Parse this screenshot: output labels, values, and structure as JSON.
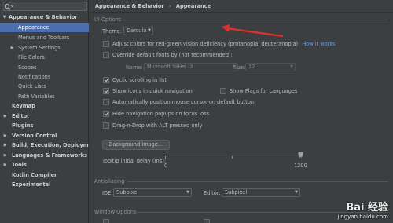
{
  "sidebar": {
    "items": [
      {
        "label": "Appearance & Behavior",
        "level": 0,
        "arrow": "down",
        "bold": true
      },
      {
        "label": "Appearance",
        "level": 1,
        "selected": true
      },
      {
        "label": "Menus and Toolbars",
        "level": 1
      },
      {
        "label": "System Settings",
        "level": 1,
        "arrow": "right"
      },
      {
        "label": "File Colors",
        "level": 1
      },
      {
        "label": "Scopes",
        "level": 1
      },
      {
        "label": "Notifications",
        "level": 1
      },
      {
        "label": "Quick Lists",
        "level": 1
      },
      {
        "label": "Path Variables",
        "level": 1
      },
      {
        "label": "Keymap",
        "level": 0,
        "bold": true
      },
      {
        "label": "Editor",
        "level": 0,
        "arrow": "right",
        "bold": true
      },
      {
        "label": "Plugins",
        "level": 0,
        "bold": true
      },
      {
        "label": "Version Control",
        "level": 0,
        "arrow": "right",
        "bold": true
      },
      {
        "label": "Build, Execution, Deployment",
        "level": 0,
        "arrow": "right",
        "bold": true
      },
      {
        "label": "Languages & Frameworks",
        "level": 0,
        "arrow": "right",
        "bold": true
      },
      {
        "label": "Tools",
        "level": 0,
        "arrow": "right",
        "bold": true
      },
      {
        "label": "Kotlin Compiler",
        "level": 0,
        "bold": true
      },
      {
        "label": "Experimental",
        "level": 0,
        "bold": true
      }
    ]
  },
  "breadcrumb": {
    "parent": "Appearance & Behavior",
    "separator": "›",
    "current": "Appearance"
  },
  "ui_options": {
    "title": "UI Options",
    "theme_label": "Theme:",
    "theme_value": "Darcula",
    "adjust_colors": {
      "label": "Adjust colors for red-green vision deficiency (protanopia, deuteranopia)",
      "link": "How it works",
      "checked": false
    },
    "override_fonts": {
      "label": "Override default fonts by (not recommended):",
      "checked": false
    },
    "font_name_label": "Name:",
    "font_name_value": "Microsoft YaHei UI",
    "font_size_label": "Size:",
    "font_size_value": "12",
    "cyclic_scrolling": {
      "label": "Cyclic scrolling in list",
      "checked": true
    },
    "show_icons_nav": {
      "label": "Show icons in quick navigation",
      "checked": true
    },
    "show_flags": {
      "label": "Show Flags for Languages",
      "checked": false
    },
    "auto_cursor": {
      "label": "Automatically position mouse cursor on default button",
      "checked": false
    },
    "hide_nav_popups": {
      "label": "Hide navigation popups on focus loss",
      "checked": true
    },
    "drag_n_drop": {
      "label": "Drag-n-Drop with ALT pressed only",
      "checked": false
    },
    "background_image_button": "Background Image...",
    "tooltip_delay_label": "Tooltip initial delay (ms):",
    "tooltip_delay_min": "0",
    "tooltip_delay_max": "1200",
    "tooltip_delay_value": 1200
  },
  "antialiasing": {
    "title": "Antialiasing",
    "ide_label": "IDE:",
    "ide_value": "Subpixel",
    "editor_label": "Editor:",
    "editor_value": "Subpixel"
  },
  "window_options": {
    "title": "Window Options"
  },
  "watermark": {
    "logo": "Bai 经验",
    "url": "jingyan.baidu.com"
  },
  "colors": {
    "accent": "#4b6eaf",
    "annotation": "#e0322c",
    "link": "#589df6"
  },
  "icons": {
    "search": "search-icon",
    "annotation": "red-arrow"
  }
}
